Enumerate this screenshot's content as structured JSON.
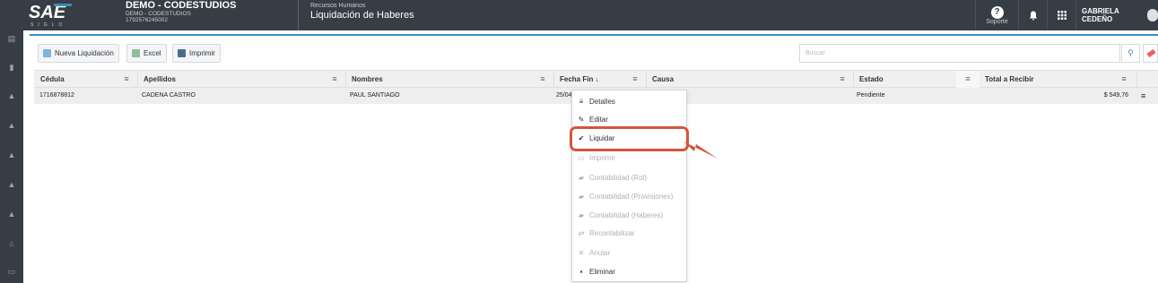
{
  "header": {
    "logo_text": "SAE",
    "logo_sub": "SIGLO",
    "company_name": "DEMO - CODESTUDIOS",
    "company_sub": "DEMO - CODESTUDIOS",
    "company_ruc": "1792576245002",
    "module_section": "Recursos Humanos",
    "module_title": "Liquidación de Haberes",
    "help_label": "Soporte",
    "user_name": "GABRIELA CEDEÑO"
  },
  "sidebar": {
    "icons": [
      "dashboard-icon",
      "document-icon",
      "graduation-cap-icon",
      "graduation-cap-icon",
      "graduation-cap-icon",
      "graduation-cap-icon",
      "graduation-cap-icon",
      "bank-icon",
      "folder-icon"
    ]
  },
  "toolbar": {
    "new_label": "Nueva Liquidación",
    "excel_label": "Excel",
    "print_label": "Imprimir",
    "search_placeholder": "Buscar"
  },
  "table": {
    "columns": [
      "Cédula",
      "Apellidos",
      "Nombres",
      "Fecha Fin ↓",
      "Causa",
      "Estado",
      "Total a Recibir"
    ],
    "rows": [
      {
        "cedula": "1716878812",
        "apellidos": "CADENA CASTRO",
        "nombres": "PAUL SANTIAGO",
        "fecha_fin": "25/04",
        "causa": "",
        "estado": "Pendiente",
        "total": "$ 549,76"
      }
    ]
  },
  "context_menu": {
    "items": [
      {
        "label": "Detalles",
        "icon": "list-icon",
        "enabled": true
      },
      {
        "label": "Editar",
        "icon": "pencil-icon",
        "enabled": true
      },
      {
        "label": "Liquidar",
        "icon": "check-icon",
        "enabled": true,
        "highlighted": true
      },
      {
        "label": "Imprimir",
        "icon": "printer-icon",
        "enabled": false
      },
      {
        "label": "Contabilidad (Rol)",
        "icon": "book-icon",
        "enabled": false
      },
      {
        "label": "Contabilidad (Provisiones)",
        "icon": "book-icon",
        "enabled": false
      },
      {
        "label": "Contabilidad (Haberes)",
        "icon": "book-icon",
        "enabled": false
      },
      {
        "label": "Recontabilizar",
        "icon": "refresh-icon",
        "enabled": false
      },
      {
        "label": "Anular",
        "icon": "x-icon",
        "enabled": false
      },
      {
        "label": "Eliminar",
        "icon": "trash-icon",
        "enabled": true
      }
    ]
  },
  "colors": {
    "topbar": "#363d44",
    "accent": "#3c8dbc",
    "highlight": "#d4553c"
  }
}
